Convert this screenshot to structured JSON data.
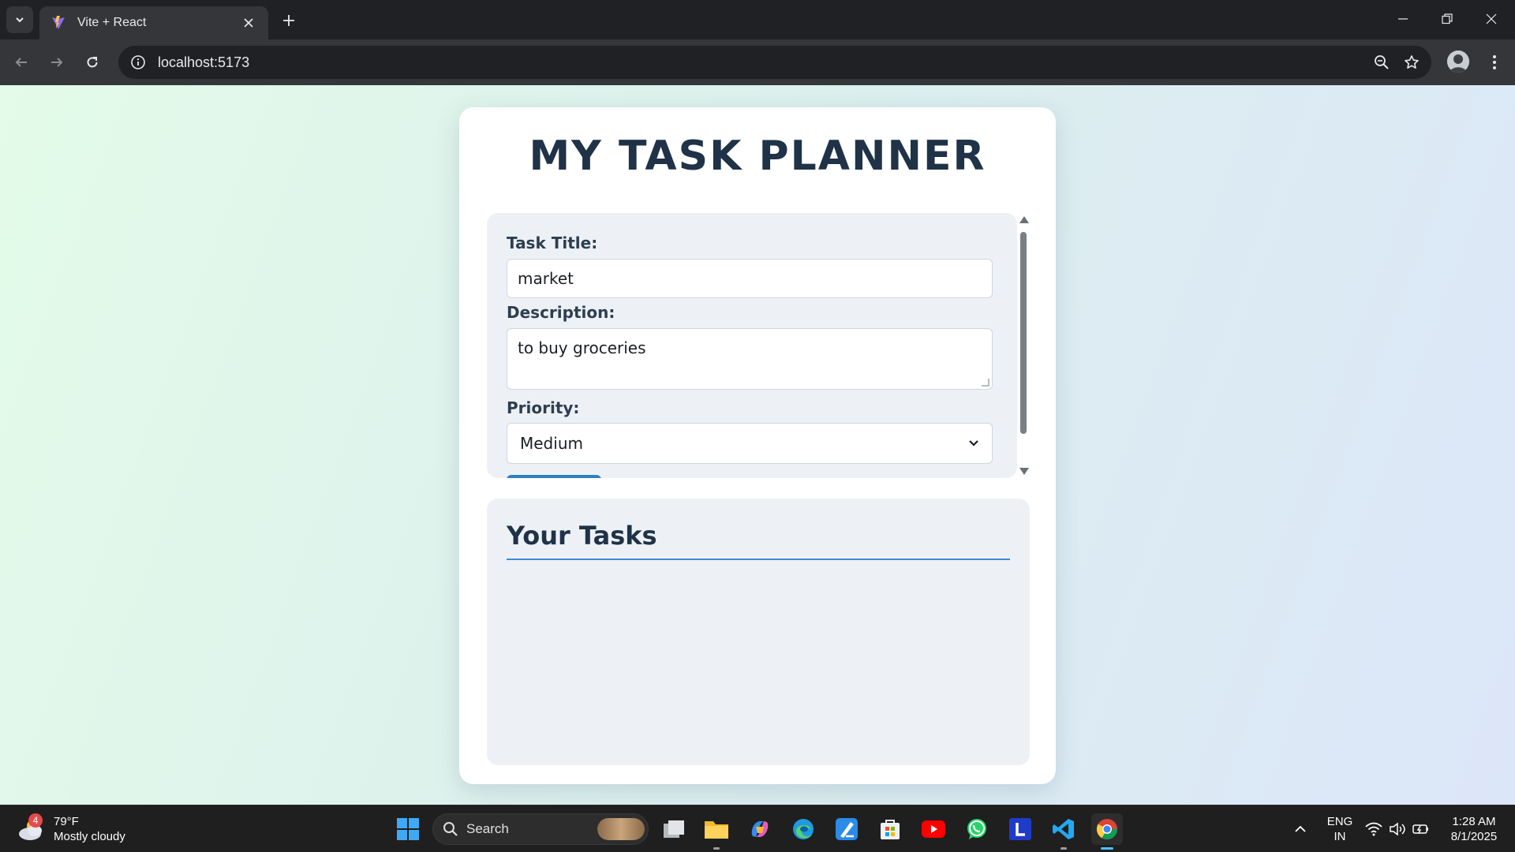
{
  "browser": {
    "tab_title": "Vite + React",
    "url": "localhost:5173"
  },
  "page": {
    "title": "MY TASK PLANNER",
    "form": {
      "title_label": "Task Title:",
      "title_value": "market",
      "description_label": "Description:",
      "description_value": "to buy groceries",
      "priority_label": "Priority:",
      "priority_value": "Medium"
    },
    "tasks_heading": "Your Tasks"
  },
  "taskbar": {
    "weather_temp": "79°F",
    "weather_desc": "Mostly cloudy",
    "weather_badge": "4",
    "search_label": "Search",
    "lang_top": "ENG",
    "lang_bottom": "IN",
    "time": "1:28 AM",
    "date": "8/1/2025"
  },
  "colors": {
    "title": "#1f3247",
    "accent": "#3d8bd6",
    "panel": "#edf1f6"
  }
}
